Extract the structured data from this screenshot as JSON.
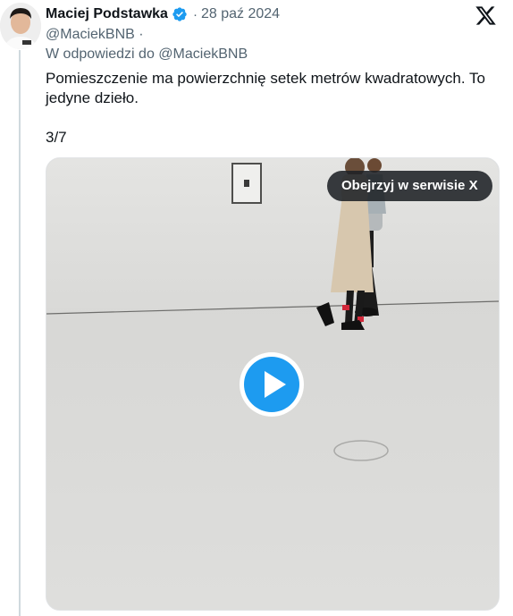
{
  "tweet": {
    "author_name": "Maciej Podstawka",
    "date": "28 paź 2024",
    "handle": "@MaciekBNB",
    "handle_separator": "·",
    "reply_prefix": "W odpowiedzi do",
    "reply_handle": "@MaciekBNB",
    "text_line1": "Pomieszczenie ma powierzchnię setek metrów kwadratowych. To",
    "text_line2": "jedyne dzieło.",
    "counter": "3/7"
  },
  "media": {
    "watch_label": "Obejrzyj w serwisie X",
    "play_icon": "play-icon"
  },
  "colors": {
    "verified": "#1d9bf0",
    "play": "#1d9bf0",
    "muted_text": "#536471",
    "pill_bg": "#1e2125"
  },
  "icons": [
    "verified-badge-icon",
    "x-logo-icon",
    "play-icon"
  ]
}
